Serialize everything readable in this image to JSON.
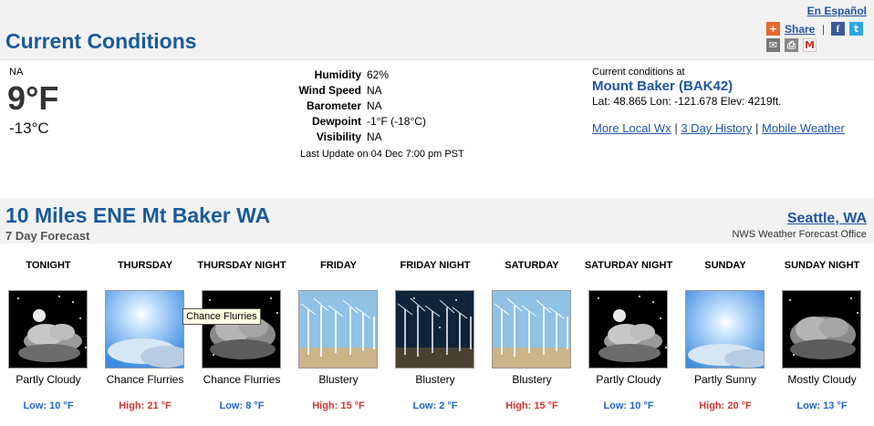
{
  "current": {
    "title": "Current Conditions",
    "espanol": "En Español",
    "share": "Share",
    "share_sep": "|",
    "condition": "NA",
    "temp_f": "9°F",
    "temp_c": "-13°C",
    "details": [
      {
        "label": "Humidity",
        "value": "62%"
      },
      {
        "label": "Wind Speed",
        "value": "NA"
      },
      {
        "label": "Barometer",
        "value": "NA"
      },
      {
        "label": "Dewpoint",
        "value": "-1°F (-18°C)"
      },
      {
        "label": "Visibility",
        "value": "NA"
      }
    ],
    "last_update": "Last Update on 04 Dec 7:00 pm PST",
    "station": {
      "caption": "Current conditions at",
      "name": "Mount Baker (BAK42)",
      "geo": "Lat: 48.865 Lon: -121.678 Elev: 4219ft.",
      "links": [
        "More Local Wx",
        "3 Day History",
        "Mobile Weather"
      ],
      "link_sep": "|"
    }
  },
  "forecast": {
    "title": "10 Miles ENE Mt Baker WA",
    "subtitle": "7 Day Forecast",
    "office": "Seattle, WA",
    "office_sub": "NWS Weather Forecast Office",
    "tooltip": "Chance Flurries",
    "periods": [
      {
        "name": "TONIGHT",
        "desc": "Partly Cloudy",
        "temp": "Low: 10 °F",
        "kind": "low",
        "icon": "night-partly-cloudy-icon"
      },
      {
        "name": "THURSDAY",
        "desc": "Chance Flurries",
        "temp": "High: 21 °F",
        "kind": "high",
        "icon": "day-sun-icon"
      },
      {
        "name": "THURSDAY NIGHT",
        "desc": "Chance Flurries",
        "temp": "Low: 8 °F",
        "kind": "low",
        "icon": "night-cloudy-icon"
      },
      {
        "name": "FRIDAY",
        "desc": "Blustery",
        "temp": "High: 15 °F",
        "kind": "high",
        "icon": "wind-turbines-icon"
      },
      {
        "name": "FRIDAY NIGHT",
        "desc": "Blustery",
        "temp": "Low: 2 °F",
        "kind": "low",
        "icon": "night-wind-turbines-icon"
      },
      {
        "name": "SATURDAY",
        "desc": "Blustery",
        "temp": "High: 15 °F",
        "kind": "high",
        "icon": "wind-turbines-icon"
      },
      {
        "name": "SATURDAY NIGHT",
        "desc": "Partly Cloudy",
        "temp": "Low: 10 °F",
        "kind": "low",
        "icon": "night-partly-cloudy-icon"
      },
      {
        "name": "SUNDAY",
        "desc": "Partly Sunny",
        "temp": "High: 20 °F",
        "kind": "high",
        "icon": "day-sun-icon"
      },
      {
        "name": "SUNDAY NIGHT",
        "desc": "Mostly Cloudy",
        "temp": "Low: 13 °F",
        "kind": "low",
        "icon": "night-cloudy-icon"
      }
    ]
  },
  "colors": {
    "title_blue": "#1a5a9c",
    "link_blue": "#2255a4",
    "low_blue": "#2266cc",
    "high_red": "#d63333"
  }
}
